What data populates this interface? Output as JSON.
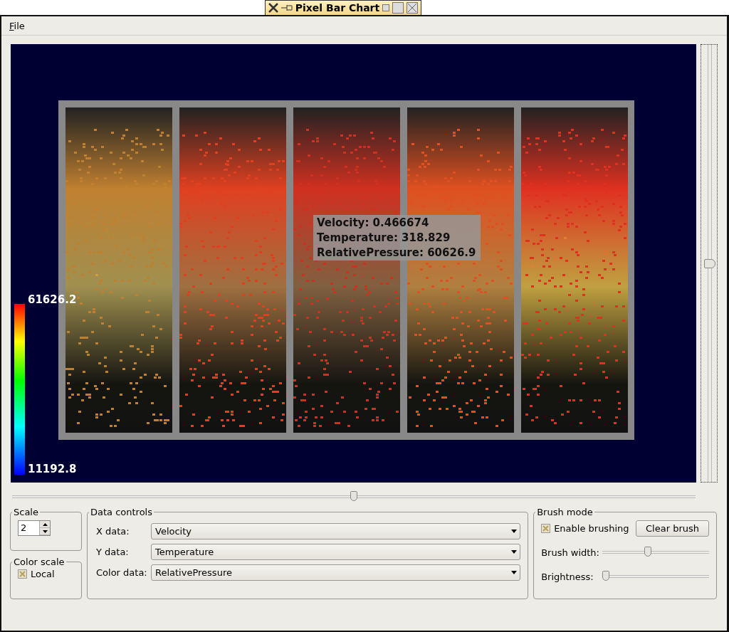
{
  "window": {
    "title": "Pixel Bar Chart"
  },
  "menu": [
    {
      "label": "File"
    }
  ],
  "color_scale_legend": {
    "max": "61626.2",
    "min": "11192.8"
  },
  "tooltip": [
    "Velocity: 0.466674",
    "Temperature: 318.829",
    "RelativePressure: 60626.9"
  ],
  "vertical_slider": {
    "level": 0.5
  },
  "horizontal_slider": {
    "level": 0.5
  },
  "scale": {
    "title": "Scale",
    "value": "2"
  },
  "color_scale": {
    "title": "Color scale",
    "option": {
      "label": "Local",
      "checked": true
    }
  },
  "data_controls": {
    "title": "Data controls",
    "rows": [
      {
        "label": "X data:",
        "value": "Velocity"
      },
      {
        "label": "Y data:",
        "value": "Temperature"
      },
      {
        "label": "Color data:",
        "value": "RelativePressure"
      }
    ]
  },
  "brush_mode": {
    "title": "Brush mode",
    "enable": {
      "label": "Enable brushing",
      "checked": true
    },
    "clear_button": "Clear brush",
    "sliders": [
      {
        "label": "Brush width:",
        "level": 0.42
      },
      {
        "label": "Brightness:",
        "level": 0
      }
    ]
  }
}
